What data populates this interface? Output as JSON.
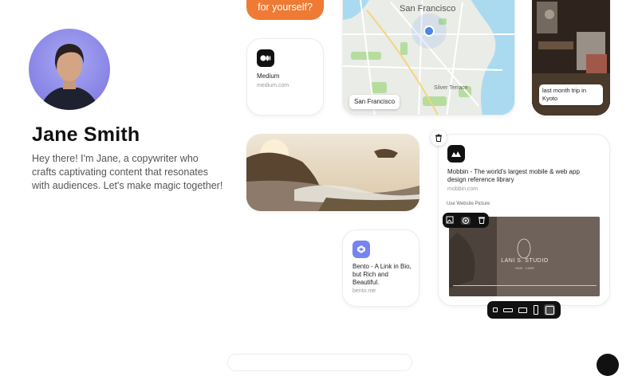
{
  "profile": {
    "name": "Jane Smith",
    "bio": "Hey there! I'm Jane, a copywriter who crafts captivating content that resonates with audiences. Let's make magic together!"
  },
  "orange_card": {
    "text": "for yourself?"
  },
  "medium_card": {
    "title": "Medium",
    "url": "medium.com"
  },
  "map_card": {
    "city_label": "San Francisco",
    "caption": "San Francisco",
    "district_label": "Silver Terrace"
  },
  "kyoto_card": {
    "caption": "last month trip in Kyoto"
  },
  "mobbin_card": {
    "title": "Mobbin - The world's largest mobile & web app design reference library",
    "url": "mobbin.com",
    "use_picture_label": "Use Website Picture",
    "studio_sign": "LANI S. STUDIO",
    "studio_sub": "SKIN · CARE"
  },
  "bento_card": {
    "title": "Bento - A Link in Bio, but Rich and Beautiful.",
    "url": "bento.me"
  },
  "colors": {
    "accent_orange": "#ee7a33",
    "map_dot": "#4a86e8",
    "avatar_bg": "#8c88e8"
  }
}
